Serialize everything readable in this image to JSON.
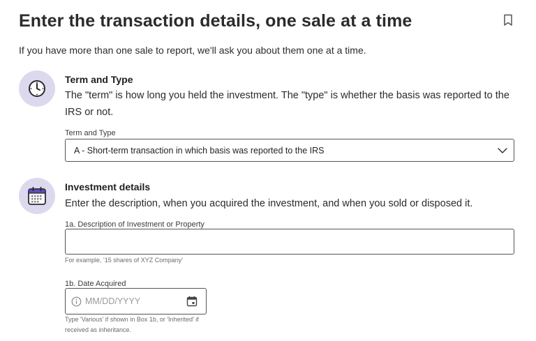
{
  "page": {
    "title": "Enter the transaction details, one sale at a time",
    "subtitle": "If you have more than one sale to report, we'll ask you about them one at a time.",
    "bookmark_icon": "bookmark-icon"
  },
  "sections": [
    {
      "icon": "clock-icon",
      "title": "Term and Type",
      "description": "The \"term\" is how long you held the investment. The \"type\" is whether the basis was reported to the IRS or not.",
      "field": {
        "label": "Term and Type",
        "selected": "A - Short-term transaction in which basis was reported to the IRS",
        "dropdown_icon": "chevron-down-icon"
      }
    },
    {
      "icon": "calendar-icon",
      "title": "Investment details",
      "description": "Enter the description, when you acquired the investment, and when you sold or disposed it.",
      "description_field": {
        "label": "1a. Description of Investment or Property",
        "value": "",
        "hint": "For example, '15 shares of XYZ Company'"
      },
      "date_field": {
        "label": "1b. Date Acquired",
        "placeholder": "MM/DD/YYYY",
        "hint": "Type 'Various' if shown in Box 1b, or 'Inherited' if received as inheritance."
      }
    }
  ],
  "colors": {
    "icon_circle": "#dcd9ef",
    "calendar_accent": "#5a4ec2",
    "border": "#555555"
  }
}
